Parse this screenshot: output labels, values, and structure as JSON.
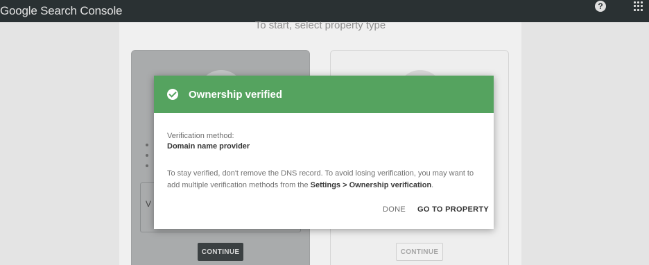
{
  "app": {
    "brand": "Google Search Console"
  },
  "topbar": {
    "help_icon": "help-circle-icon",
    "apps_icon": "apps-grid-icon"
  },
  "background": {
    "prompt": "To start, select property type",
    "inner_field_char": "V",
    "continue_left": "CONTINUE",
    "continue_right": "CONTINUE"
  },
  "modal": {
    "title": "Ownership verified",
    "title_icon": "check-circle-icon",
    "method_label": "Verification method:",
    "method_value": "Domain name provider",
    "note_text": "To stay verified, don't remove the DNS record. To avoid losing verification, you may want to add multiple verification methods from the",
    "note_link": "Settings > Ownership verification",
    "note_end": ".",
    "done_label": "DONE",
    "goto_label": "GO TO PROPERTY"
  },
  "colors": {
    "header_green": "#55a35f",
    "topbar": "#2a3133"
  }
}
